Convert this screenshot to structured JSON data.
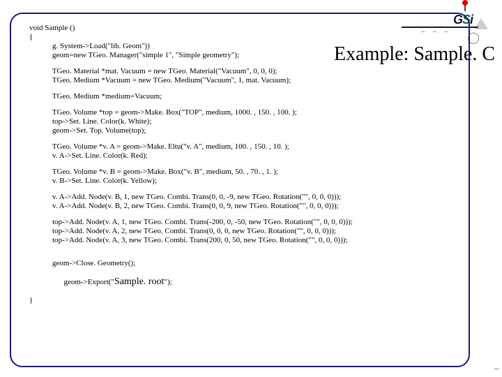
{
  "logo": {
    "text_a": "G",
    "text_b": "S",
    "text_c": "i",
    "dots": "─  ─  ─",
    "ring": "◯",
    "corner": "⎯"
  },
  "title": "Example: Sample. C",
  "code": {
    "l01": "void Sample ()",
    "l02": "{",
    "l03": "            g. System->Load(\"lib. Geom\"))",
    "l04": "            geom=new TGeo. Manager(\"simple 1\", \"Simple geometry\");",
    "l05": "            TGeo. Material *mat. Vacuum = new TGeo. Material(\"Vacuum\", 0, 0, 0);",
    "l06": "            TGeo. Medium *Vacuum = new TGeo. Medium(\"Vacuum\", 1, mat. Vacuum);",
    "l07": "            TGeo. Medium *medium=Vacuum;",
    "l08": "            TGeo. Volume *top = geom->Make. Box(\"TOP\", medium, 1000. , 150. , 100. );",
    "l09": "            top->Set. Line. Color(k. White);",
    "l10": "            geom->Set. Top. Volume(top);",
    "l11": "            TGeo. Volume *v. A = geom->Make. Eltu(\"v. A\", medium, 100. , 150. , 10. );",
    "l12": "            v. A->Set. Line. Color(k. Red);",
    "l13": "            TGeo. Volume *v. B = geom->Make. Box(\"v. B\", medium, 50. , 70. , 1. );",
    "l14": "            v. B->Set. Line. Color(k. Yellow);",
    "l15": "            v. A->Add. Node(v. B, 1, new TGeo. Combi. Trans(0, 0, -9, new TGeo. Rotation(\"\", 0, 0, 0)));",
    "l16": "            v. A->Add. Node(v. B, 2, new TGeo. Combi. Trans(0, 0, 9, new TGeo. Rotation(\"\", 0, 0, 0)));",
    "l17": "            top->Add. Node(v. A, 1, new TGeo. Combi. Trans(-200, 0, -50, new TGeo. Rotation(\"\", 0, 0, 0)));",
    "l18": "            top->Add. Node(v. A, 2, new TGeo. Combi. Trans(0, 0, 0, new TGeo. Rotation(\"\", 0, 0, 0)));",
    "l19": "            top->Add. Node(v. A, 3, new TGeo. Combi. Trans(200, 0, 50, new TGeo. Rotation(\"\", 0, 0, 0)));",
    "l20": "            geom->Close. Geometry();",
    "l21a": "            geom->Export(\"",
    "l21b": "Sample. root",
    "l21c": "\");",
    "l22": "}"
  }
}
